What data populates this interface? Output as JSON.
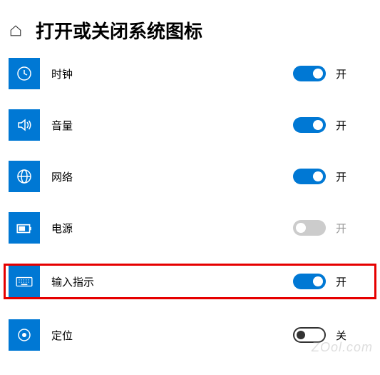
{
  "header": {
    "title": "打开或关闭系统图标"
  },
  "items": [
    {
      "icon": "clock",
      "label": "时钟",
      "on": true,
      "state": "开",
      "style": "on",
      "highlight": false
    },
    {
      "icon": "volume",
      "label": "音量",
      "on": true,
      "state": "开",
      "style": "on",
      "highlight": false
    },
    {
      "icon": "network",
      "label": "网络",
      "on": true,
      "state": "开",
      "style": "on",
      "highlight": false
    },
    {
      "icon": "power",
      "label": "电源",
      "on": false,
      "state": "开",
      "style": "off-gray",
      "highlight": false,
      "muted": true
    },
    {
      "icon": "ime",
      "label": "输入指示",
      "on": true,
      "state": "开",
      "style": "on",
      "highlight": true
    },
    {
      "icon": "location",
      "label": "定位",
      "on": false,
      "state": "关",
      "style": "off-outline",
      "highlight": false
    }
  ],
  "watermark": "ZOol.com"
}
